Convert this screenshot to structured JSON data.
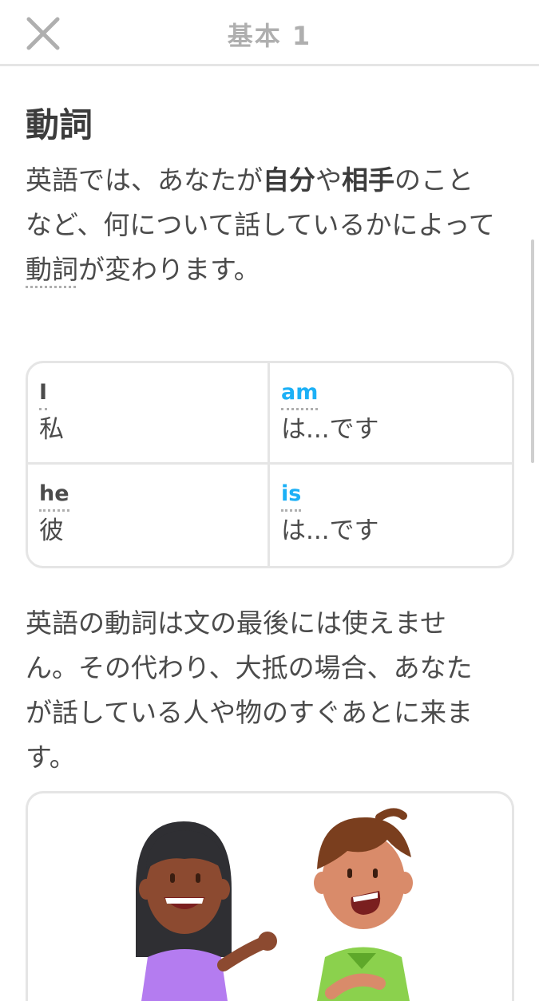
{
  "header": {
    "title": "基本 1",
    "close_icon": "close-icon"
  },
  "lesson": {
    "title": "動詞",
    "intro": {
      "p1": "英語では、あなたが",
      "b1": "自分",
      "p2": "や",
      "b2": "相手",
      "p3": "のことなど、何について話しているかによって",
      "u1": "動詞",
      "p4": "が変わります。"
    },
    "table": {
      "rows": [
        [
          {
            "word": "I",
            "meaning": "私"
          },
          {
            "word": "am",
            "meaning": "は...です"
          }
        ],
        [
          {
            "word": "he",
            "meaning": "彼"
          },
          {
            "word": "is",
            "meaning": "は...です"
          }
        ]
      ]
    },
    "second_paragraph": "英語の動詞は文の最後には使えません。その代わり、大抵の場合、あなたが話している人や物のすぐあとに来ます。"
  },
  "colors": {
    "verb_highlight": "#1cb0f6",
    "border": "#e5e5e5",
    "text": "#4b4b4b",
    "header_title": "#afafaf"
  }
}
